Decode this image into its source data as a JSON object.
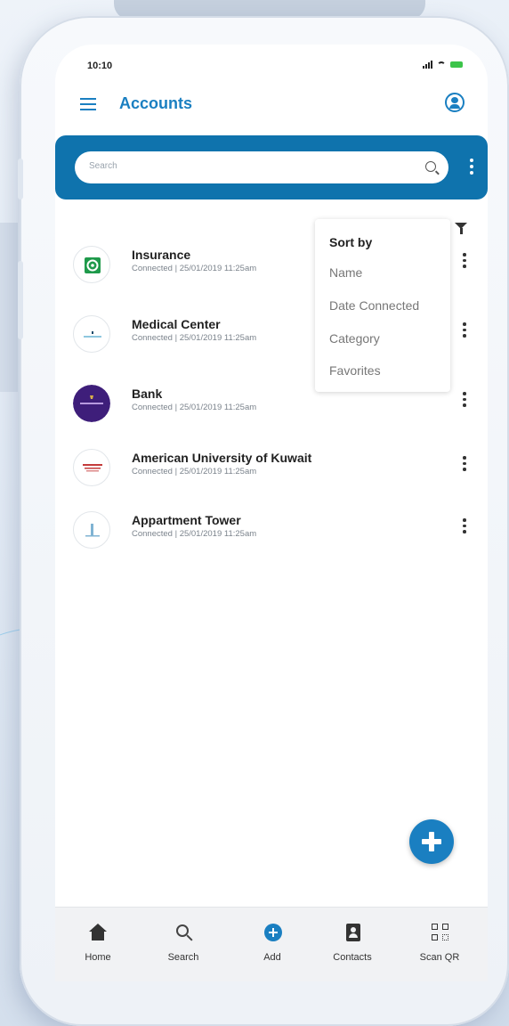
{
  "status_bar": {
    "time": "10:10"
  },
  "header": {
    "title": "Accounts"
  },
  "search": {
    "placeholder": "Search"
  },
  "sort_menu": {
    "title": "Sort by",
    "options": [
      "Name",
      "Date Connected",
      "Category",
      "Favorites"
    ]
  },
  "accounts": [
    {
      "name": "Insurance",
      "meta": "Connected | 25/01/2019 11:25am"
    },
    {
      "name": "Medical Center",
      "meta": "Connected | 25/01/2019 11:25am"
    },
    {
      "name": "Bank",
      "meta": "Connected | 25/01/2019 11:25am"
    },
    {
      "name": "American University of Kuwait",
      "meta": "Connected | 25/01/2019 11:25am"
    },
    {
      "name": "Appartment Tower",
      "meta": "Connected | 25/01/2019 11:25am"
    }
  ],
  "bottom_nav": {
    "home": "Home",
    "search": "Search",
    "add": "Add",
    "contacts": "Contacts",
    "scan_qr": "Scan QR"
  },
  "colors": {
    "accent": "#1a7fc1",
    "search_bar": "#0f73ad",
    "status_battery": "#3cc44a"
  },
  "icons": {
    "menu": "hamburger-icon",
    "profile": "user-circle-icon",
    "search": "search-icon",
    "filter": "filter-icon",
    "more": "kebab-icon",
    "fab": "plus-icon"
  }
}
